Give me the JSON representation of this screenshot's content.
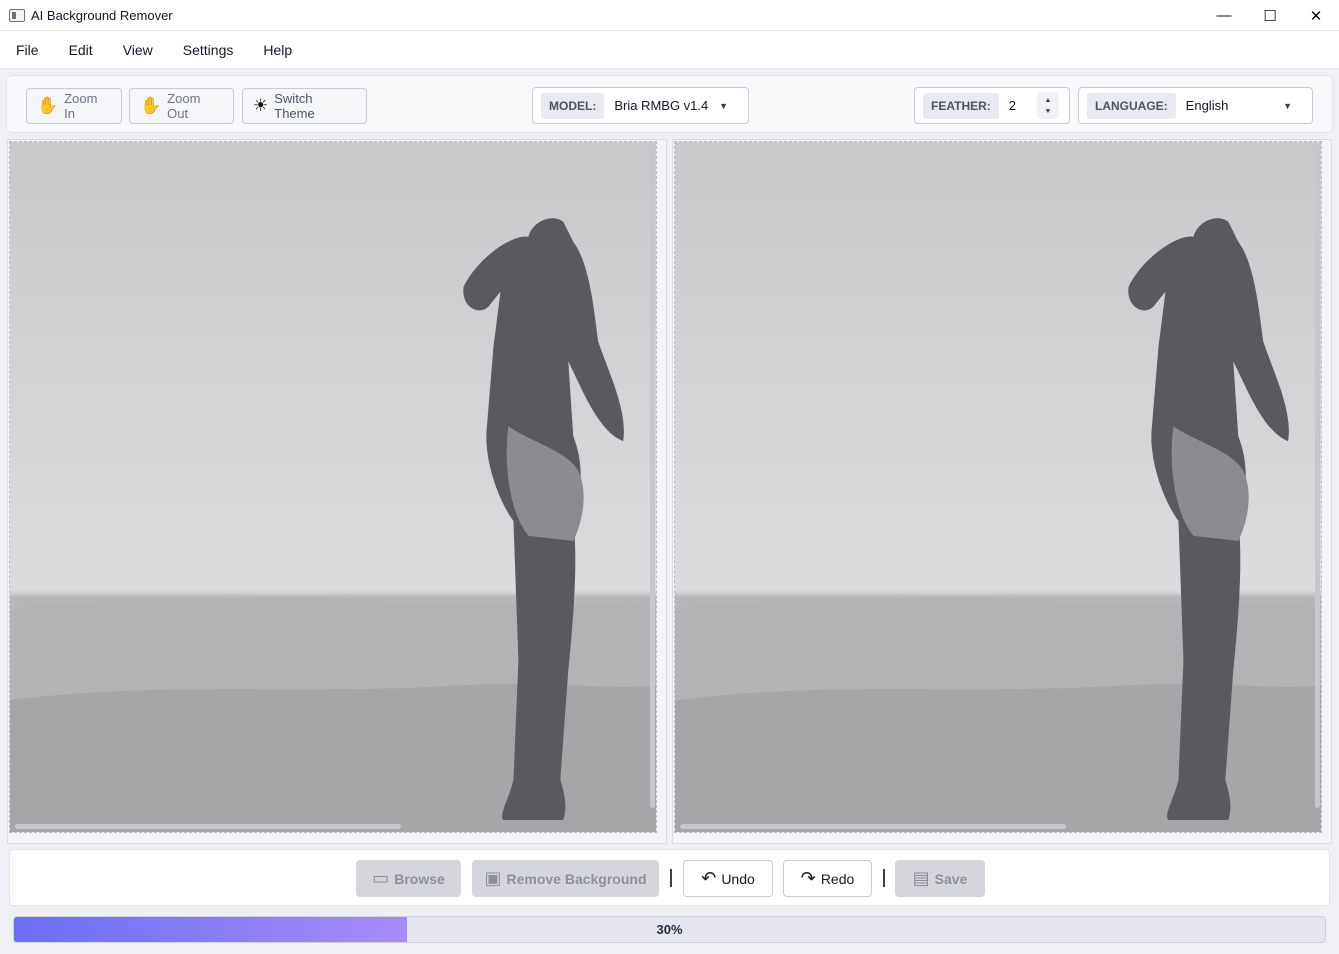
{
  "window": {
    "title": "AI Background Remover",
    "minimize_glyph": "—",
    "maximize_glyph": "☐",
    "close_glyph": "✕"
  },
  "menu": [
    "File",
    "Edit",
    "View",
    "Settings",
    "Help"
  ],
  "toolbar": {
    "zoom_in_label": "Zoom In",
    "zoom_out_label": "Zoom Out",
    "switch_theme_label": "Switch Theme",
    "model_label": "MODEL:",
    "model_value": "Bria RMBG v1.4",
    "feather_label": "FEATHER:",
    "feather_value": "2",
    "language_label": "LANGUAGE:",
    "language_value": "English"
  },
  "actions": {
    "browse_label": "Browse",
    "remove_background_label": "Remove Background",
    "undo_label": "Undo",
    "redo_label": "Redo",
    "save_label": "Save"
  },
  "progress": {
    "percent": 30,
    "text": "30%"
  },
  "colors": {
    "progress_start": "#6b6ef7",
    "progress_end": "#a78bfa",
    "disabled_button": "#d5d6dc"
  }
}
